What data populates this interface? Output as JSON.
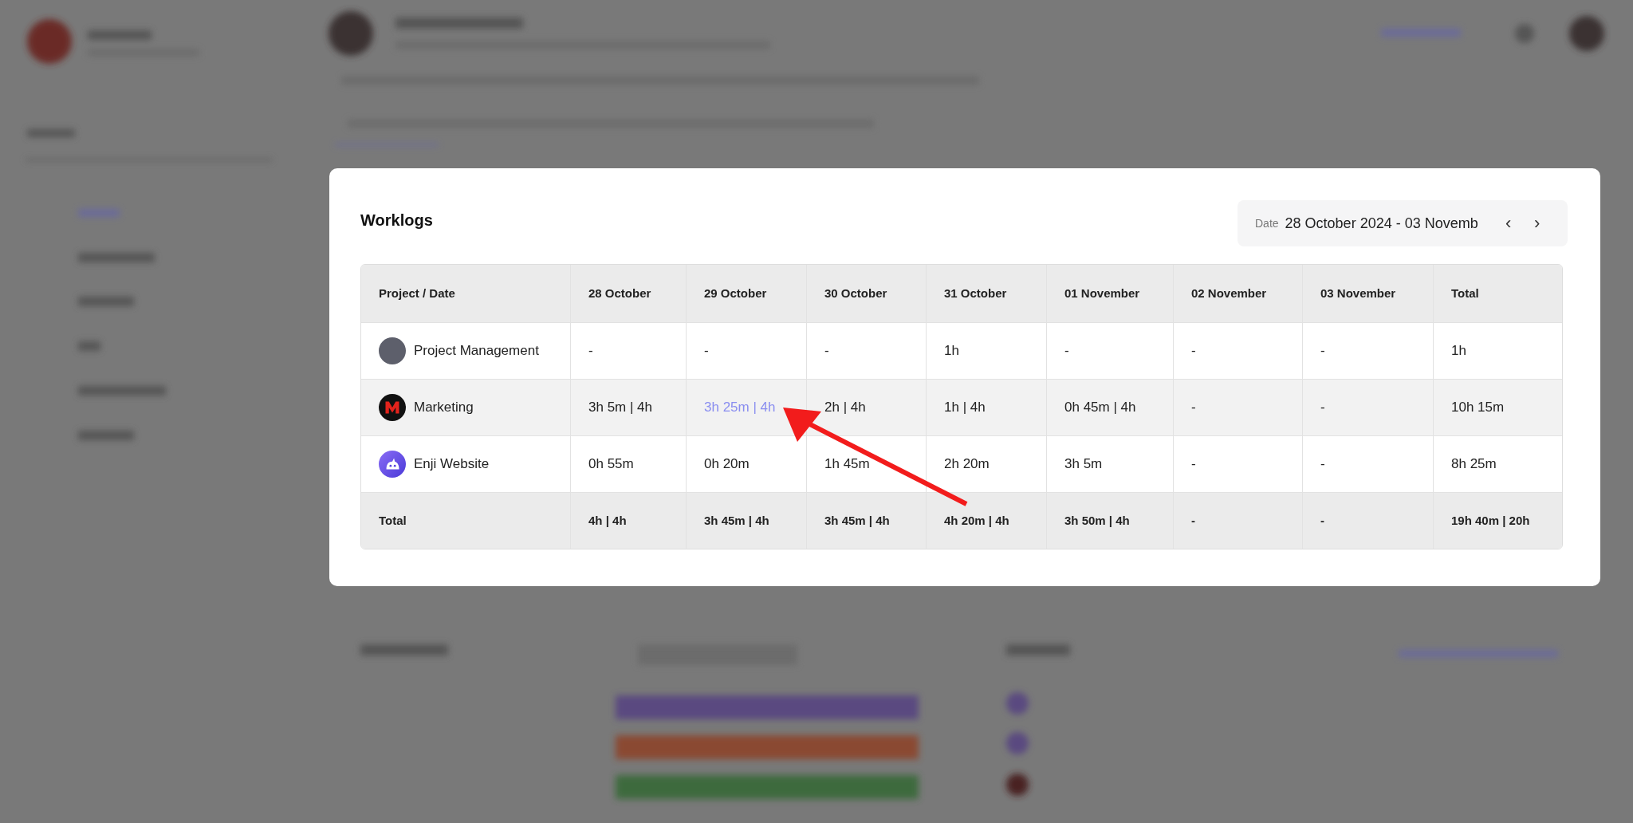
{
  "worklogs": {
    "title": "Worklogs",
    "date_filter": {
      "label": "Date",
      "value": "28 October 2024 - 03 Novemb",
      "prev": "‹",
      "next": "›"
    },
    "table": {
      "project_column": "Project / Date",
      "columns": [
        "28 October",
        "29 October",
        "30 October",
        "31 October",
        "01 November",
        "02 November",
        "03 November",
        "Total"
      ],
      "rows": [
        {
          "project": "Project Management",
          "kind": "photo",
          "hovered": false,
          "cells": [
            {
              "text": "-",
              "highlighted": false
            },
            {
              "text": "-",
              "highlighted": false
            },
            {
              "text": "-",
              "highlighted": false
            },
            {
              "text": "1h",
              "highlighted": false
            },
            {
              "text": "-",
              "highlighted": false
            },
            {
              "text": "-",
              "highlighted": false
            },
            {
              "text": "-",
              "highlighted": false
            },
            {
              "text": "1h",
              "highlighted": false
            }
          ]
        },
        {
          "project": "Marketing",
          "kind": "m-logo",
          "hovered": true,
          "cells": [
            {
              "text": "3h 5m | 4h",
              "highlighted": false
            },
            {
              "text": "3h 25m | 4h",
              "highlighted": true
            },
            {
              "text": "2h | 4h",
              "highlighted": false
            },
            {
              "text": "1h | 4h",
              "highlighted": false
            },
            {
              "text": "0h 45m | 4h",
              "highlighted": false
            },
            {
              "text": "-",
              "highlighted": false
            },
            {
              "text": "-",
              "highlighted": false
            },
            {
              "text": "10h 15m",
              "highlighted": false
            }
          ]
        },
        {
          "project": "Enji Website",
          "kind": "bot-logo",
          "hovered": false,
          "cells": [
            {
              "text": "0h 55m",
              "highlighted": false
            },
            {
              "text": "0h 20m",
              "highlighted": false
            },
            {
              "text": "1h 45m",
              "highlighted": false
            },
            {
              "text": "2h 20m",
              "highlighted": false
            },
            {
              "text": "3h 5m",
              "highlighted": false
            },
            {
              "text": "-",
              "highlighted": false
            },
            {
              "text": "-",
              "highlighted": false
            },
            {
              "text": "8h 25m",
              "highlighted": false
            }
          ]
        }
      ],
      "total": {
        "label": "Total",
        "cells": [
          "4h | 4h",
          "3h 45m | 4h",
          "3h 45m | 4h",
          "4h 20m | 4h",
          "3h 50m | 4h",
          "-",
          "-",
          "19h 40m | 20h"
        ]
      }
    }
  }
}
